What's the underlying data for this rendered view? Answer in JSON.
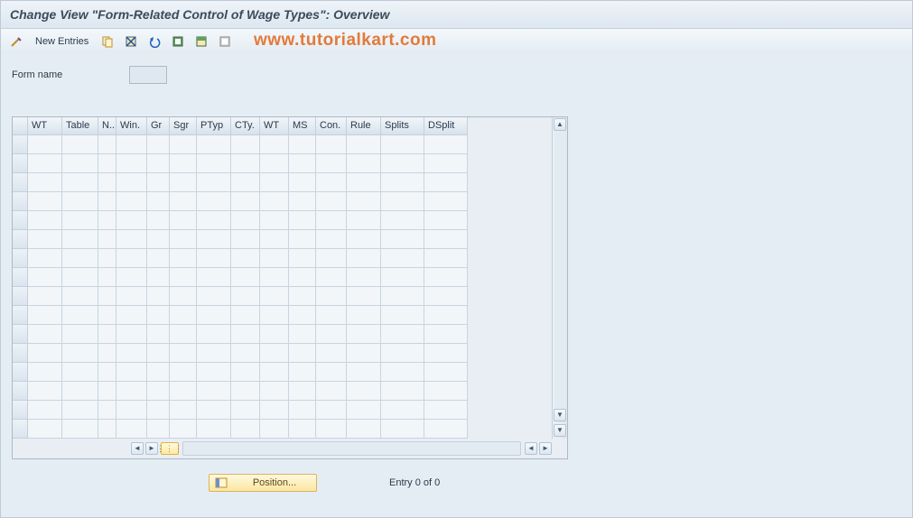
{
  "title": "Change View \"Form-Related Control of Wage Types\": Overview",
  "toolbar": {
    "new_entries": "New Entries"
  },
  "watermark": "www.tutorialkart.com",
  "form": {
    "name_label": "Form name",
    "name_value": ""
  },
  "grid": {
    "columns": [
      "WT",
      "Table",
      "N..",
      "Win.",
      "Gr",
      "Sgr",
      "PTyp",
      "CTy.",
      "WT",
      "MS",
      "Con.",
      "Rule",
      "Splits",
      "DSplit"
    ],
    "row_count": 16
  },
  "footer": {
    "position_btn": "Position...",
    "entry_text": "Entry 0 of 0"
  },
  "icons": {
    "pencil": "pencil",
    "copy": "copy",
    "save": "save",
    "undo": "undo",
    "selectall": "selectall",
    "selectblock": "selectblock",
    "deselect": "deselect"
  }
}
